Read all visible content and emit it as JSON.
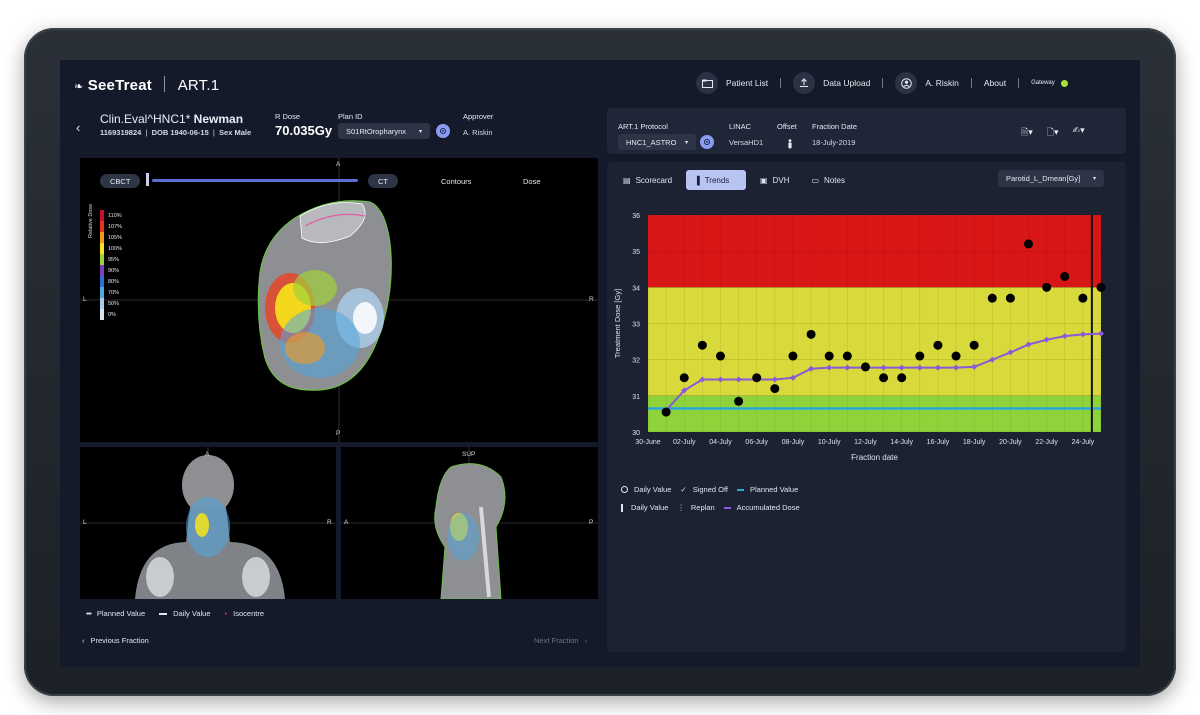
{
  "header": {
    "brand": "SeeTreat",
    "app": "ART.1",
    "nav": [
      "Patient List",
      "Data Upload",
      "A. Riskin",
      "About"
    ],
    "gateway": "Gateway",
    "gateway_color": "#a6e23a"
  },
  "patient": {
    "name_prefix": "Clin.Eval^HNC1*",
    "name": "Newman",
    "id": "1169319824",
    "dob_label": "DOB",
    "dob": "1940-06-15",
    "sex_label": "Sex",
    "sex": "Male",
    "rdose_label": "R Dose",
    "rdose": "70.035Gy",
    "plan_label": "Plan ID",
    "plan": "S01RtOropharynx",
    "approver_label": "Approver",
    "approver": "A. Riskin"
  },
  "viewer": {
    "cbct": "CBCT",
    "ct": "CT",
    "contours": "Contours",
    "dose": "Dose",
    "axial": {
      "top": "A",
      "bottom": "P",
      "left": "L",
      "right": "R"
    },
    "coronal": {
      "top": "A",
      "left": "L",
      "right": "R"
    },
    "sagittal": {
      "top": "SUP",
      "left": "A",
      "right": "P"
    },
    "dose_axis": "Relative Dose",
    "dose_scale": [
      {
        "label": "110%",
        "color": "#c8102e"
      },
      {
        "label": "107%",
        "color": "#e8331f"
      },
      {
        "label": "105%",
        "color": "#f39a1e"
      },
      {
        "label": "100%",
        "color": "#f6e51b"
      },
      {
        "label": "95%",
        "color": "#9fd23a"
      },
      {
        "label": "90%",
        "color": "#7b3fb8"
      },
      {
        "label": "80%",
        "color": "#2f6fd3"
      },
      {
        "label": "70%",
        "color": "#52a8e0"
      },
      {
        "label": "50%",
        "color": "#a9cbe6"
      },
      {
        "label": "0%",
        "color": "#d8e2ea"
      }
    ],
    "legend": [
      "Planned Value",
      "Daily Value",
      "Isocentre"
    ],
    "prev": "Previous Fraction",
    "next": "Next Fraction"
  },
  "protocol": {
    "protocol_label": "ART.1 Protocol",
    "protocol": "HNC1_ASTRO",
    "linac_label": "LINAC",
    "linac": "VersaHD1",
    "offset_label": "Offset",
    "fraction_label": "Fraction Date",
    "fraction": "18-July-2019"
  },
  "tabs": [
    "Scorecard",
    "Trends",
    "DVH",
    "Notes"
  ],
  "metric": "Parotid_L_Dmean[Gy]",
  "legend_chart": {
    "row1": [
      "Daily Value",
      "Signed Off",
      "Planned Value"
    ],
    "row2": [
      "Daily Value",
      "Replan",
      "Accumulated Dose"
    ]
  },
  "chart_data": {
    "type": "line",
    "ylabel": "Treatment Dose [Gy]",
    "xlabel": "Fraction date",
    "ylim": [
      30,
      36
    ],
    "yticks": [
      "30",
      "31",
      "32",
      "33",
      "34",
      "35",
      "36"
    ],
    "xlim": [
      0,
      25
    ],
    "xticks": [
      {
        "x": 0,
        "label": "30-June"
      },
      {
        "x": 2,
        "label": "02-July"
      },
      {
        "x": 4,
        "label": "04-July"
      },
      {
        "x": 6,
        "label": "06-July"
      },
      {
        "x": 8,
        "label": "08-July"
      },
      {
        "x": 10,
        "label": "10-July"
      },
      {
        "x": 12,
        "label": "12-July"
      },
      {
        "x": 14,
        "label": "14-July"
      },
      {
        "x": 16,
        "label": "16-July"
      },
      {
        "x": 18,
        "label": "18-July"
      },
      {
        "x": 20,
        "label": "20-July"
      },
      {
        "x": 22,
        "label": "22-July"
      },
      {
        "x": 24,
        "label": "24-July"
      }
    ],
    "bands": [
      {
        "from": 34,
        "to": 36,
        "color": "#d91616"
      },
      {
        "from": 31,
        "to": 34,
        "color": "#d8d93a"
      },
      {
        "from": 30,
        "to": 31,
        "color": "#8fd33a"
      }
    ],
    "planned_value": 30.65,
    "replan_x": 24,
    "daily": [
      {
        "x": 1,
        "y": 30.55
      },
      {
        "x": 2,
        "y": 31.5
      },
      {
        "x": 3,
        "y": 32.4
      },
      {
        "x": 4,
        "y": 32.1
      },
      {
        "x": 5,
        "y": 30.85
      },
      {
        "x": 6,
        "y": 31.5
      },
      {
        "x": 7,
        "y": 31.2
      },
      {
        "x": 8,
        "y": 32.1
      },
      {
        "x": 9,
        "y": 32.7
      },
      {
        "x": 10,
        "y": 32.1
      },
      {
        "x": 11,
        "y": 32.1
      },
      {
        "x": 12,
        "y": 31.8
      },
      {
        "x": 13,
        "y": 31.5
      },
      {
        "x": 14,
        "y": 31.5
      },
      {
        "x": 15,
        "y": 32.1
      },
      {
        "x": 16,
        "y": 32.4
      },
      {
        "x": 17,
        "y": 32.1
      },
      {
        "x": 18,
        "y": 32.4
      },
      {
        "x": 19,
        "y": 33.7
      },
      {
        "x": 20,
        "y": 33.7
      },
      {
        "x": 21,
        "y": 35.2
      },
      {
        "x": 22,
        "y": 34.0
      },
      {
        "x": 23,
        "y": 34.3
      },
      {
        "x": 24,
        "y": 33.7
      },
      {
        "x": 25,
        "y": 34.0
      }
    ],
    "accumulated": [
      {
        "x": 1,
        "y": 30.6
      },
      {
        "x": 2,
        "y": 31.15
      },
      {
        "x": 3,
        "y": 31.45
      },
      {
        "x": 4,
        "y": 31.45
      },
      {
        "x": 5,
        "y": 31.45
      },
      {
        "x": 6,
        "y": 31.45
      },
      {
        "x": 7,
        "y": 31.45
      },
      {
        "x": 8,
        "y": 31.5
      },
      {
        "x": 9,
        "y": 31.75
      },
      {
        "x": 10,
        "y": 31.78
      },
      {
        "x": 11,
        "y": 31.78
      },
      {
        "x": 12,
        "y": 31.78
      },
      {
        "x": 13,
        "y": 31.78
      },
      {
        "x": 14,
        "y": 31.78
      },
      {
        "x": 15,
        "y": 31.78
      },
      {
        "x": 16,
        "y": 31.78
      },
      {
        "x": 17,
        "y": 31.78
      },
      {
        "x": 18,
        "y": 31.8
      },
      {
        "x": 19,
        "y": 32.0
      },
      {
        "x": 20,
        "y": 32.2
      },
      {
        "x": 21,
        "y": 32.42
      },
      {
        "x": 22,
        "y": 32.55
      },
      {
        "x": 23,
        "y": 32.65
      },
      {
        "x": 24,
        "y": 32.7
      },
      {
        "x": 25,
        "y": 32.72
      }
    ],
    "colors": {
      "daily": "#000000",
      "accumulated": "#8a5ad8",
      "planned": "#2ba6d9",
      "replan": "#111111"
    }
  }
}
